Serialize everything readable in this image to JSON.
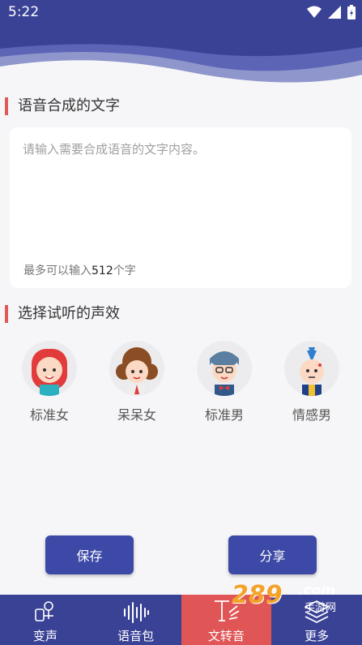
{
  "status_bar": {
    "time": "5:22"
  },
  "text_section": {
    "title": "语音合成的文字",
    "placeholder": "请输入需要合成语音的文字内容。",
    "limit_prefix": "最多可以输入",
    "limit_number": "512",
    "limit_suffix": "个字"
  },
  "voice_section": {
    "title": "选择试听的声效",
    "voices": [
      {
        "label": "标准女",
        "icon": "girl-avatar-icon"
      },
      {
        "label": "呆呆女",
        "icon": "curly-girl-avatar-icon"
      },
      {
        "label": "标准男",
        "icon": "boy-avatar-icon"
      },
      {
        "label": "情感男",
        "icon": "mohawk-man-avatar-icon"
      }
    ]
  },
  "actions": {
    "save": "保存",
    "share": "分享"
  },
  "tabs": [
    {
      "label": "变声",
      "icon": "voice-change-icon",
      "active": false
    },
    {
      "label": "语音包",
      "icon": "waveform-icon",
      "active": false
    },
    {
      "label": "文转音",
      "icon": "text-to-speech-icon",
      "active": true
    },
    {
      "label": "更多",
      "icon": "layers-icon",
      "active": false
    }
  ],
  "watermark": {
    "brand": "289",
    "suffix": ".com",
    "sub": "手游网"
  },
  "colors": {
    "primary": "#3a4296",
    "accent": "#e05656",
    "button": "#3c49a6"
  }
}
